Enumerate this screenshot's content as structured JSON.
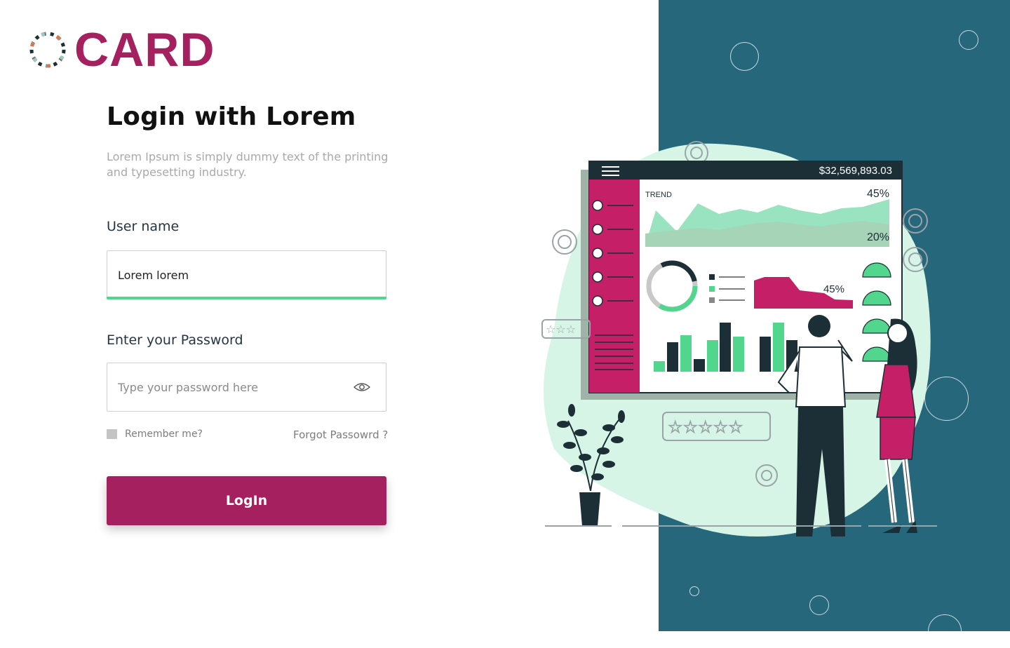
{
  "brand": {
    "name": "CARD",
    "color": "#a5205f"
  },
  "login": {
    "title": "Login with Lorem",
    "subtitle": "Lorem Ipsum is simply dummy text of the printing and typesetting industry.",
    "username_label": "User name",
    "username_value": "Lorem lorem",
    "password_label": "Enter your Password",
    "password_placeholder": "Type your password here",
    "remember_label": "Remember me?",
    "forgot_label": "Forgot Passowrd ?",
    "button_label": "LogIn",
    "show_password_icon": "eye-icon"
  },
  "illustration": {
    "amount": "$32,569,893.03",
    "trend_label": "TREND",
    "trend_high": "45%",
    "trend_low": "20%",
    "area_percent": "45%",
    "rating_stars": 5
  },
  "colors": {
    "primary": "#a5205f",
    "accent_green": "#52d68e",
    "panel": "#27677c",
    "mint": "#d6f5e6",
    "dark": "#1c2e36"
  }
}
